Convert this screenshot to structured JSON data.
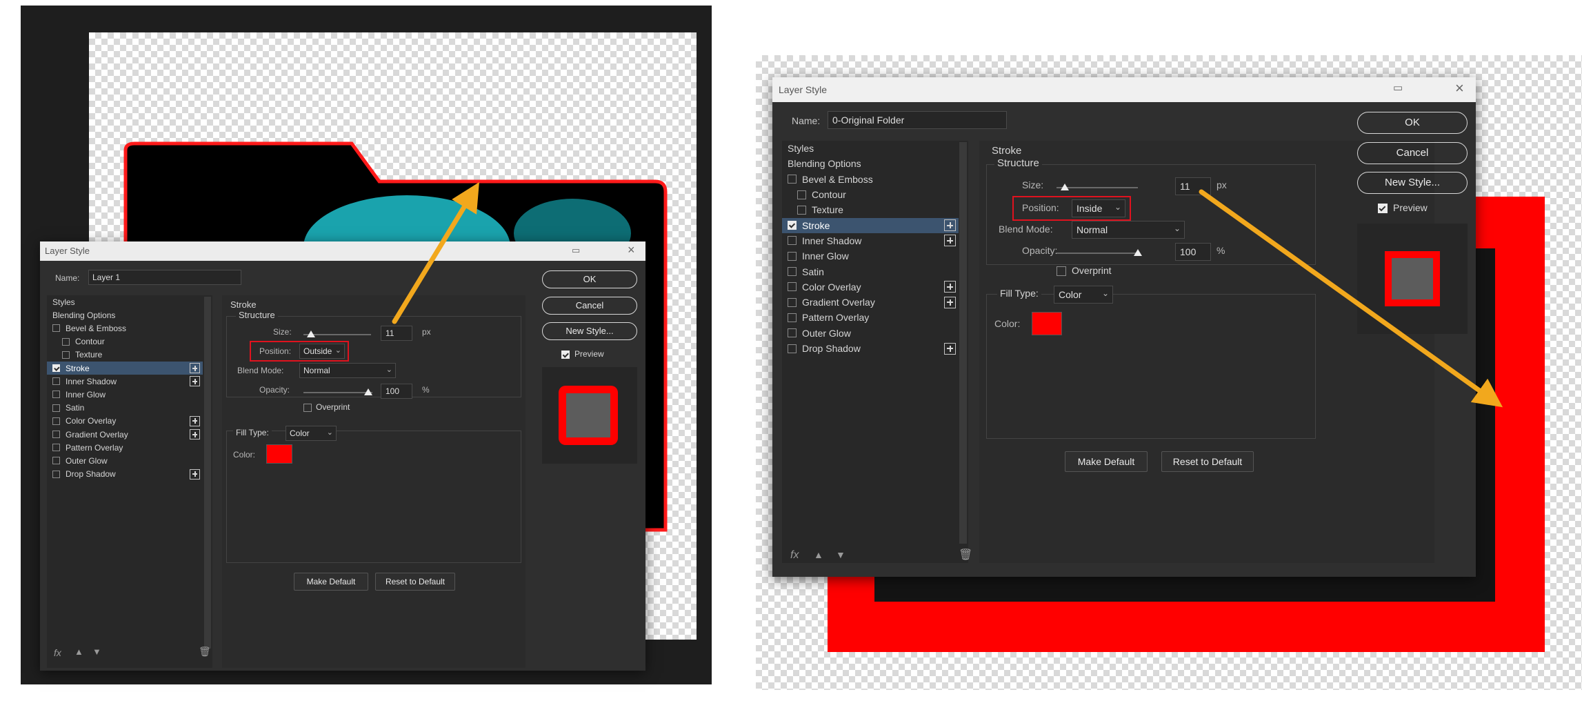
{
  "left": {
    "title": "Layer Style",
    "name_label": "Name:",
    "name_value": "Layer 1",
    "styles": [
      {
        "label": "Styles",
        "checkbox": false,
        "checked": false,
        "plus": false,
        "selected": false
      },
      {
        "label": "Blending Options",
        "checkbox": false,
        "checked": false,
        "plus": false,
        "selected": false
      },
      {
        "label": "Bevel & Emboss",
        "checkbox": true,
        "checked": false,
        "plus": false,
        "selected": false
      },
      {
        "label": "Contour",
        "checkbox": true,
        "checked": false,
        "plus": false,
        "selected": false,
        "indent": true
      },
      {
        "label": "Texture",
        "checkbox": true,
        "checked": false,
        "plus": false,
        "selected": false,
        "indent": true
      },
      {
        "label": "Stroke",
        "checkbox": true,
        "checked": true,
        "plus": true,
        "selected": true
      },
      {
        "label": "Inner Shadow",
        "checkbox": true,
        "checked": false,
        "plus": true,
        "selected": false
      },
      {
        "label": "Inner Glow",
        "checkbox": true,
        "checked": false,
        "plus": false,
        "selected": false
      },
      {
        "label": "Satin",
        "checkbox": true,
        "checked": false,
        "plus": false,
        "selected": false
      },
      {
        "label": "Color Overlay",
        "checkbox": true,
        "checked": false,
        "plus": true,
        "selected": false
      },
      {
        "label": "Gradient Overlay",
        "checkbox": true,
        "checked": false,
        "plus": true,
        "selected": false
      },
      {
        "label": "Pattern Overlay",
        "checkbox": true,
        "checked": false,
        "plus": false,
        "selected": false
      },
      {
        "label": "Outer Glow",
        "checkbox": true,
        "checked": false,
        "plus": false,
        "selected": false
      },
      {
        "label": "Drop Shadow",
        "checkbox": true,
        "checked": false,
        "plus": true,
        "selected": false
      }
    ],
    "section_title": "Stroke",
    "structure_label": "Structure",
    "size_label": "Size:",
    "size_value": "11",
    "size_unit": "px",
    "position_label": "Position:",
    "position_value": "Outside",
    "blend_label": "Blend Mode:",
    "blend_value": "Normal",
    "opacity_label": "Opacity:",
    "opacity_value": "100",
    "opacity_unit": "%",
    "overprint_label": "Overprint",
    "filltype_label": "Fill Type:",
    "filltype_value": "Color",
    "color_label": "Color:",
    "make_default": "Make Default",
    "reset_default": "Reset to Default",
    "ok": "OK",
    "cancel": "Cancel",
    "new_style": "New Style...",
    "preview": "Preview",
    "fx": "fx"
  },
  "right": {
    "title": "Layer Style",
    "name_label": "Name:",
    "name_value": "0-Original Folder",
    "styles": [
      {
        "label": "Styles",
        "checkbox": false,
        "checked": false,
        "plus": false,
        "selected": false
      },
      {
        "label": "Blending Options",
        "checkbox": false,
        "checked": false,
        "plus": false,
        "selected": false
      },
      {
        "label": "Bevel & Emboss",
        "checkbox": true,
        "checked": false,
        "plus": false,
        "selected": false
      },
      {
        "label": "Contour",
        "checkbox": true,
        "checked": false,
        "plus": false,
        "selected": false,
        "indent": true
      },
      {
        "label": "Texture",
        "checkbox": true,
        "checked": false,
        "plus": false,
        "selected": false,
        "indent": true
      },
      {
        "label": "Stroke",
        "checkbox": true,
        "checked": true,
        "plus": true,
        "selected": true
      },
      {
        "label": "Inner Shadow",
        "checkbox": true,
        "checked": false,
        "plus": true,
        "selected": false
      },
      {
        "label": "Inner Glow",
        "checkbox": true,
        "checked": false,
        "plus": false,
        "selected": false
      },
      {
        "label": "Satin",
        "checkbox": true,
        "checked": false,
        "plus": false,
        "selected": false
      },
      {
        "label": "Color Overlay",
        "checkbox": true,
        "checked": false,
        "plus": true,
        "selected": false
      },
      {
        "label": "Gradient Overlay",
        "checkbox": true,
        "checked": false,
        "plus": true,
        "selected": false
      },
      {
        "label": "Pattern Overlay",
        "checkbox": true,
        "checked": false,
        "plus": false,
        "selected": false
      },
      {
        "label": "Outer Glow",
        "checkbox": true,
        "checked": false,
        "plus": false,
        "selected": false
      },
      {
        "label": "Drop Shadow",
        "checkbox": true,
        "checked": false,
        "plus": true,
        "selected": false
      }
    ],
    "section_title": "Stroke",
    "structure_label": "Structure",
    "size_label": "Size:",
    "size_value": "11",
    "size_unit": "px",
    "position_label": "Position:",
    "position_value": "Inside",
    "blend_label": "Blend Mode:",
    "blend_value": "Normal",
    "opacity_label": "Opacity:",
    "opacity_value": "100",
    "opacity_unit": "%",
    "overprint_label": "Overprint",
    "filltype_label": "Fill Type:",
    "filltype_value": "Color",
    "color_label": "Color:",
    "make_default": "Make Default",
    "reset_default": "Reset to Default",
    "ok": "OK",
    "cancel": "Cancel",
    "new_style": "New Style...",
    "preview": "Preview",
    "fx": "fx"
  },
  "colors": {
    "stroke_color": "#ff0000",
    "annotation_arrow": "#f2a81d",
    "highlight_box": "#e0121e",
    "dialog_bg": "#2f2f2f",
    "selected_row": "#3c546f"
  }
}
